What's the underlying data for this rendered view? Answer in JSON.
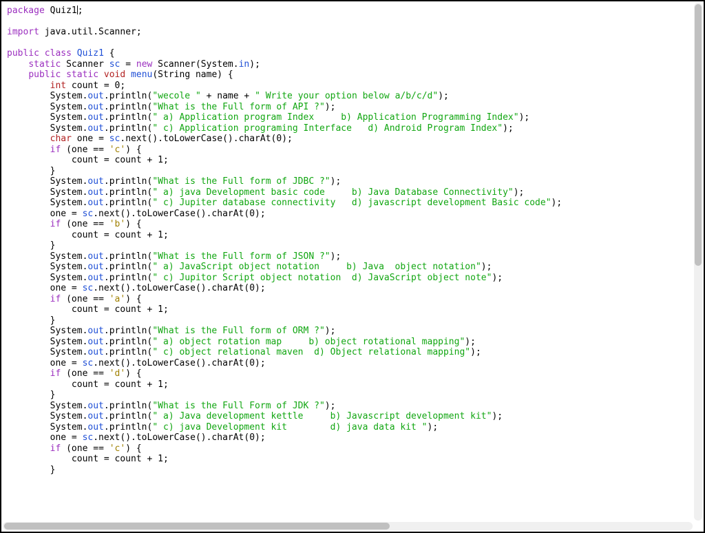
{
  "code": {
    "lines": [
      [
        {
          "cls": "kw-purple",
          "t": "package"
        },
        {
          "cls": "",
          "t": " Quiz1"
        },
        {
          "cls": "cursor",
          "t": ""
        },
        {
          "cls": "",
          "t": ";"
        }
      ],
      [],
      [
        {
          "cls": "kw-purple",
          "t": "import"
        },
        {
          "cls": "",
          "t": " java.util.Scanner;"
        }
      ],
      [],
      [
        {
          "cls": "kw-purple",
          "t": "public"
        },
        {
          "cls": "",
          "t": " "
        },
        {
          "cls": "kw-purple",
          "t": "class"
        },
        {
          "cls": "",
          "t": " "
        },
        {
          "cls": "kw-blue",
          "t": "Quiz1"
        },
        {
          "cls": "",
          "t": " {"
        }
      ],
      [
        {
          "cls": "",
          "t": "    "
        },
        {
          "cls": "kw-purple",
          "t": "static"
        },
        {
          "cls": "",
          "t": " Scanner "
        },
        {
          "cls": "kw-blue",
          "t": "sc"
        },
        {
          "cls": "",
          "t": " = "
        },
        {
          "cls": "kw-purple",
          "t": "new"
        },
        {
          "cls": "",
          "t": " Scanner(System."
        },
        {
          "cls": "kw-blue",
          "t": "in"
        },
        {
          "cls": "",
          "t": ");"
        }
      ],
      [
        {
          "cls": "",
          "t": "    "
        },
        {
          "cls": "kw-purple",
          "t": "public"
        },
        {
          "cls": "",
          "t": " "
        },
        {
          "cls": "kw-purple",
          "t": "static"
        },
        {
          "cls": "",
          "t": " "
        },
        {
          "cls": "type-red",
          "t": "void"
        },
        {
          "cls": "",
          "t": " "
        },
        {
          "cls": "kw-blue",
          "t": "menu"
        },
        {
          "cls": "",
          "t": "(String name) {"
        }
      ],
      [
        {
          "cls": "",
          "t": "        "
        },
        {
          "cls": "type-red",
          "t": "int"
        },
        {
          "cls": "",
          "t": " count = 0;"
        }
      ],
      [
        {
          "cls": "",
          "t": "        System."
        },
        {
          "cls": "kw-blue",
          "t": "out"
        },
        {
          "cls": "",
          "t": ".println("
        },
        {
          "cls": "str",
          "t": "\"wecole \""
        },
        {
          "cls": "",
          "t": " + name + "
        },
        {
          "cls": "str",
          "t": "\" Write your option below a/b/c/d\""
        },
        {
          "cls": "",
          "t": ");"
        }
      ],
      [
        {
          "cls": "",
          "t": "        System."
        },
        {
          "cls": "kw-blue",
          "t": "out"
        },
        {
          "cls": "",
          "t": ".println("
        },
        {
          "cls": "str",
          "t": "\"What is the Full form of API ?\""
        },
        {
          "cls": "",
          "t": ");"
        }
      ],
      [
        {
          "cls": "",
          "t": "        System."
        },
        {
          "cls": "kw-blue",
          "t": "out"
        },
        {
          "cls": "",
          "t": ".println("
        },
        {
          "cls": "str",
          "t": "\" a) Application program Index     b) Application Programming Index\""
        },
        {
          "cls": "",
          "t": ");"
        }
      ],
      [
        {
          "cls": "",
          "t": "        System."
        },
        {
          "cls": "kw-blue",
          "t": "out"
        },
        {
          "cls": "",
          "t": ".println("
        },
        {
          "cls": "str",
          "t": "\" c) Application programing Interface   d) Android Program Index\""
        },
        {
          "cls": "",
          "t": ");"
        }
      ],
      [
        {
          "cls": "",
          "t": "        "
        },
        {
          "cls": "type-red",
          "t": "char"
        },
        {
          "cls": "",
          "t": " one = "
        },
        {
          "cls": "kw-blue",
          "t": "sc"
        },
        {
          "cls": "",
          "t": ".next().toLowerCase().charAt(0);"
        }
      ],
      [
        {
          "cls": "",
          "t": "        "
        },
        {
          "cls": "kw-purple",
          "t": "if"
        },
        {
          "cls": "",
          "t": " (one == "
        },
        {
          "cls": "charlit",
          "t": "'c'"
        },
        {
          "cls": "",
          "t": ") {"
        }
      ],
      [
        {
          "cls": "",
          "t": "            count = count + 1;"
        }
      ],
      [
        {
          "cls": "",
          "t": "        }"
        }
      ],
      [
        {
          "cls": "",
          "t": "        System."
        },
        {
          "cls": "kw-blue",
          "t": "out"
        },
        {
          "cls": "",
          "t": ".println("
        },
        {
          "cls": "str",
          "t": "\"What is the Full form of JDBC ?\""
        },
        {
          "cls": "",
          "t": ");"
        }
      ],
      [
        {
          "cls": "",
          "t": "        System."
        },
        {
          "cls": "kw-blue",
          "t": "out"
        },
        {
          "cls": "",
          "t": ".println("
        },
        {
          "cls": "str",
          "t": "\" a) java Development basic code     b) Java Database Connectivity\""
        },
        {
          "cls": "",
          "t": ");"
        }
      ],
      [
        {
          "cls": "",
          "t": "        System."
        },
        {
          "cls": "kw-blue",
          "t": "out"
        },
        {
          "cls": "",
          "t": ".println("
        },
        {
          "cls": "str",
          "t": "\" c) Jupiter database connectivity   d) javascript development Basic code\""
        },
        {
          "cls": "",
          "t": ");"
        }
      ],
      [
        {
          "cls": "",
          "t": "        one = "
        },
        {
          "cls": "kw-blue",
          "t": "sc"
        },
        {
          "cls": "",
          "t": ".next().toLowerCase().charAt(0);"
        }
      ],
      [
        {
          "cls": "",
          "t": "        "
        },
        {
          "cls": "kw-purple",
          "t": "if"
        },
        {
          "cls": "",
          "t": " (one == "
        },
        {
          "cls": "charlit",
          "t": "'b'"
        },
        {
          "cls": "",
          "t": ") {"
        }
      ],
      [
        {
          "cls": "",
          "t": "            count = count + 1;"
        }
      ],
      [
        {
          "cls": "",
          "t": "        }"
        }
      ],
      [
        {
          "cls": "",
          "t": "        System."
        },
        {
          "cls": "kw-blue",
          "t": "out"
        },
        {
          "cls": "",
          "t": ".println("
        },
        {
          "cls": "str",
          "t": "\"What is the Full form of JSON ?\""
        },
        {
          "cls": "",
          "t": ");"
        }
      ],
      [
        {
          "cls": "",
          "t": "        System."
        },
        {
          "cls": "kw-blue",
          "t": "out"
        },
        {
          "cls": "",
          "t": ".println("
        },
        {
          "cls": "str",
          "t": "\" a) JavaScript object notation     b) Java  object notation\""
        },
        {
          "cls": "",
          "t": ");"
        }
      ],
      [
        {
          "cls": "",
          "t": "        System."
        },
        {
          "cls": "kw-blue",
          "t": "out"
        },
        {
          "cls": "",
          "t": ".println("
        },
        {
          "cls": "str",
          "t": "\" c) Jupitor Script object notation  d) JavaScript object note\""
        },
        {
          "cls": "",
          "t": ");"
        }
      ],
      [
        {
          "cls": "",
          "t": "        one = "
        },
        {
          "cls": "kw-blue",
          "t": "sc"
        },
        {
          "cls": "",
          "t": ".next().toLowerCase().charAt(0);"
        }
      ],
      [
        {
          "cls": "",
          "t": "        "
        },
        {
          "cls": "kw-purple",
          "t": "if"
        },
        {
          "cls": "",
          "t": " (one == "
        },
        {
          "cls": "charlit",
          "t": "'a'"
        },
        {
          "cls": "",
          "t": ") {"
        }
      ],
      [
        {
          "cls": "",
          "t": "            count = count + 1;"
        }
      ],
      [
        {
          "cls": "",
          "t": "        }"
        }
      ],
      [
        {
          "cls": "",
          "t": "        System."
        },
        {
          "cls": "kw-blue",
          "t": "out"
        },
        {
          "cls": "",
          "t": ".println("
        },
        {
          "cls": "str",
          "t": "\"What is the Full form of ORM ?\""
        },
        {
          "cls": "",
          "t": ");"
        }
      ],
      [
        {
          "cls": "",
          "t": "        System."
        },
        {
          "cls": "kw-blue",
          "t": "out"
        },
        {
          "cls": "",
          "t": ".println("
        },
        {
          "cls": "str",
          "t": "\" a) object rotation map     b) object rotational mapping\""
        },
        {
          "cls": "",
          "t": ");"
        }
      ],
      [
        {
          "cls": "",
          "t": "        System."
        },
        {
          "cls": "kw-blue",
          "t": "out"
        },
        {
          "cls": "",
          "t": ".println("
        },
        {
          "cls": "str",
          "t": "\" c) object relational maven  d) Object relational mapping\""
        },
        {
          "cls": "",
          "t": ");"
        }
      ],
      [
        {
          "cls": "",
          "t": "        one = "
        },
        {
          "cls": "kw-blue",
          "t": "sc"
        },
        {
          "cls": "",
          "t": ".next().toLowerCase().charAt(0);"
        }
      ],
      [
        {
          "cls": "",
          "t": "        "
        },
        {
          "cls": "kw-purple",
          "t": "if"
        },
        {
          "cls": "",
          "t": " (one == "
        },
        {
          "cls": "charlit",
          "t": "'d'"
        },
        {
          "cls": "",
          "t": ") {"
        }
      ],
      [
        {
          "cls": "",
          "t": "            count = count + 1;"
        }
      ],
      [
        {
          "cls": "",
          "t": "        }"
        }
      ],
      [
        {
          "cls": "",
          "t": "        System."
        },
        {
          "cls": "kw-blue",
          "t": "out"
        },
        {
          "cls": "",
          "t": ".println("
        },
        {
          "cls": "str",
          "t": "\"What is the Full Form of JDK ?\""
        },
        {
          "cls": "",
          "t": ");"
        }
      ],
      [
        {
          "cls": "",
          "t": "        System."
        },
        {
          "cls": "kw-blue",
          "t": "out"
        },
        {
          "cls": "",
          "t": ".println("
        },
        {
          "cls": "str",
          "t": "\" a) Java development kettle     b) Javascript development kit\""
        },
        {
          "cls": "",
          "t": ");"
        }
      ],
      [
        {
          "cls": "",
          "t": "        System."
        },
        {
          "cls": "kw-blue",
          "t": "out"
        },
        {
          "cls": "",
          "t": ".println("
        },
        {
          "cls": "str",
          "t": "\" c) java Development kit        d) java data kit \""
        },
        {
          "cls": "",
          "t": ");"
        }
      ],
      [
        {
          "cls": "",
          "t": "        one = "
        },
        {
          "cls": "kw-blue",
          "t": "sc"
        },
        {
          "cls": "",
          "t": ".next().toLowerCase().charAt(0);"
        }
      ],
      [
        {
          "cls": "",
          "t": "        "
        },
        {
          "cls": "kw-purple",
          "t": "if"
        },
        {
          "cls": "",
          "t": " (one == "
        },
        {
          "cls": "charlit",
          "t": "'c'"
        },
        {
          "cls": "",
          "t": ") {"
        }
      ],
      [
        {
          "cls": "",
          "t": "            count = count + 1;"
        }
      ],
      [
        {
          "cls": "",
          "t": "        }"
        }
      ]
    ]
  }
}
